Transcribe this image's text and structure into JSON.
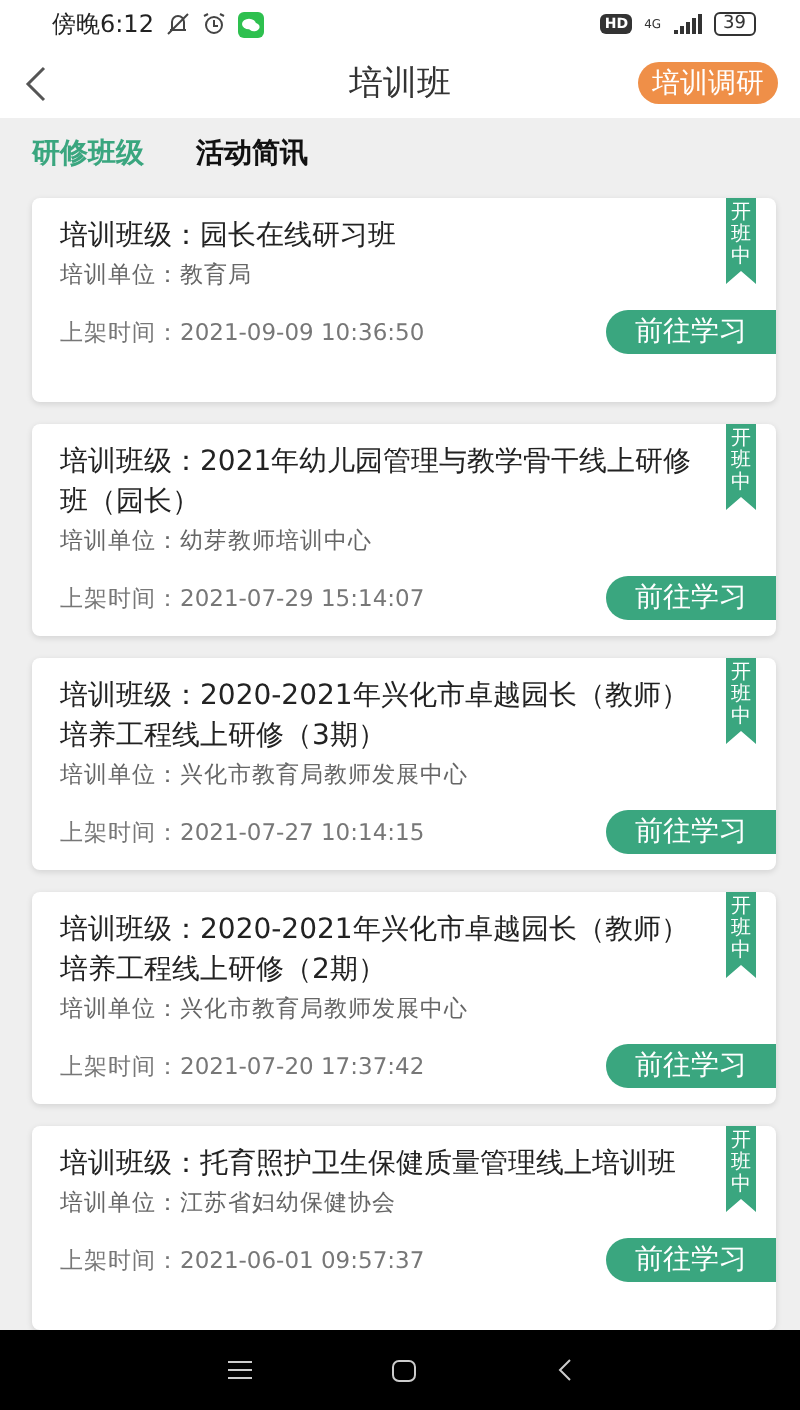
{
  "status_bar": {
    "time": "傍晚6:12",
    "hd": "HD",
    "network": "4G",
    "battery": "39"
  },
  "header": {
    "title": "培训班",
    "action": "培训调研"
  },
  "tabs": [
    {
      "label": "研修班级",
      "selected": true
    },
    {
      "label": "活动简讯",
      "selected": false
    }
  ],
  "classes": [
    {
      "title": "培训班级：园长在线研习班",
      "unit": "培训单位：教育局",
      "time": "上架时间：2021-09-09 10:36:50",
      "ribbon": "开班中",
      "button": "前往学习"
    },
    {
      "title": "培训班级：2021年幼儿园管理与教学骨干线上研修班（园长）",
      "unit": "培训单位：幼芽教师培训中心",
      "time": "上架时间：2021-07-29 15:14:07",
      "ribbon": "开班中",
      "button": "前往学习"
    },
    {
      "title": "培训班级：2020-2021年兴化市卓越园长（教师）培养工程线上研修（3期）",
      "unit": "培训单位：兴化市教育局教师发展中心",
      "time": "上架时间：2021-07-27 10:14:15",
      "ribbon": "开班中",
      "button": "前往学习"
    },
    {
      "title": "培训班级：2020-2021年兴化市卓越园长（教师）培养工程线上研修（2期）",
      "unit": "培训单位：兴化市教育局教师发展中心",
      "time": "上架时间：2021-07-20 17:37:42",
      "ribbon": "开班中",
      "button": "前往学习"
    },
    {
      "title": "培训班级：托育照护卫生保健质量管理线上培训班",
      "unit": "培训单位：江苏省妇幼保健协会",
      "time": "上架时间：2021-06-01 09:57:37",
      "ribbon": "开班中",
      "button": "前往学习"
    }
  ]
}
